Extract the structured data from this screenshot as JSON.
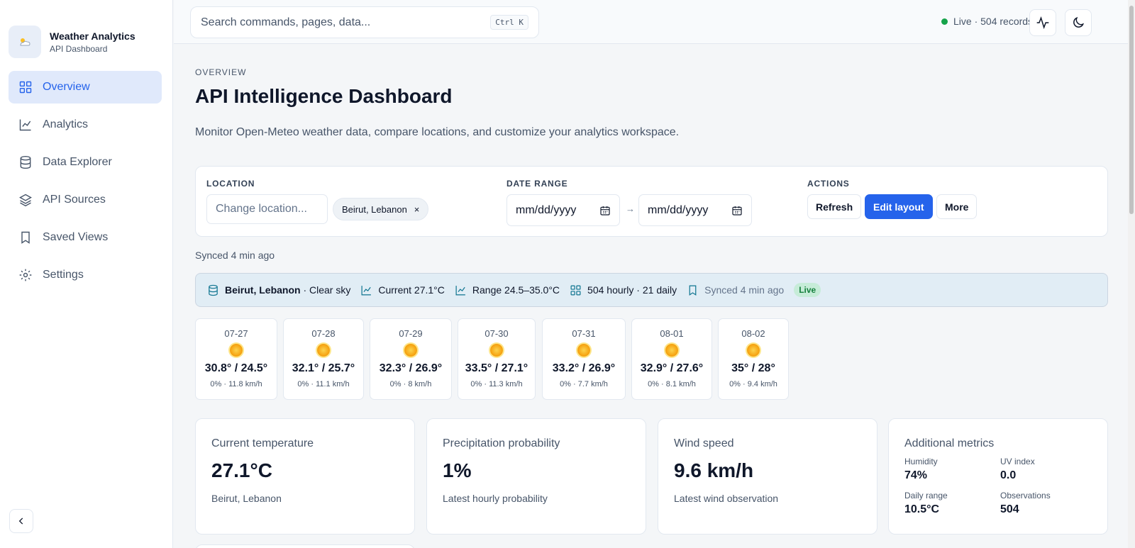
{
  "brand": {
    "title": "Weather Analytics",
    "subtitle": "API Dashboard",
    "logo_icon": "cloud-sun-icon"
  },
  "sidebar": {
    "items": [
      {
        "label": "Overview",
        "icon": "grid-icon",
        "active": true
      },
      {
        "label": "Analytics",
        "icon": "chart-line-icon",
        "active": false
      },
      {
        "label": "Data Explorer",
        "icon": "database-icon",
        "active": false
      },
      {
        "label": "API Sources",
        "icon": "layers-icon",
        "active": false
      },
      {
        "label": "Saved Views",
        "icon": "bookmark-icon",
        "active": false
      },
      {
        "label": "Settings",
        "icon": "gear-icon",
        "active": false
      }
    ],
    "collapse_icon": "chevron-left-icon"
  },
  "topbar": {
    "search_placeholder": "Search commands, pages, data...",
    "shortcut": "Ctrl K",
    "status": "Live · 504 records",
    "activity_icon": "activity-icon",
    "theme_icon": "moon-icon"
  },
  "page": {
    "breadcrumb": "OVERVIEW",
    "title": "API Intelligence Dashboard",
    "subtitle": "Monitor Open-Meteo weather data, compare locations, and customize your analytics workspace."
  },
  "controls": {
    "location_label": "LOCATION",
    "location_placeholder": "Change location...",
    "location_chip": "Beirut, Lebanon",
    "chip_close": "×",
    "date_label": "DATE RANGE",
    "date_from_placeholder": "mm/dd/yyyy",
    "date_to_placeholder": "mm/dd/yyyy",
    "arrow": "→",
    "actions_label": "ACTIONS",
    "refresh": "Refresh",
    "edit_layout": "Edit layout",
    "more": "More"
  },
  "synced": "Synced 4 min ago",
  "infobar": {
    "location": "Beirut, Lebanon",
    "condition": "· Clear sky",
    "current": "Current 27.1°C",
    "range": "Range 24.5–35.0°C",
    "records": "504 hourly · 21 daily",
    "synced": "Synced 4 min ago",
    "badge": "Live",
    "accent": "#0e7490"
  },
  "forecast": [
    {
      "date": "07-27",
      "temp": "30.8° / 24.5°",
      "meta": "0% · 11.8 km/h",
      "icon": "sun-icon"
    },
    {
      "date": "07-28",
      "temp": "32.1° / 25.7°",
      "meta": "0% · 11.1 km/h",
      "icon": "sun-icon"
    },
    {
      "date": "07-29",
      "temp": "32.3° / 26.9°",
      "meta": "0% · 8 km/h",
      "icon": "sun-icon"
    },
    {
      "date": "07-30",
      "temp": "33.5° / 27.1°",
      "meta": "0% · 11.3 km/h",
      "icon": "sun-icon"
    },
    {
      "date": "07-31",
      "temp": "33.2° / 26.9°",
      "meta": "0% · 7.7 km/h",
      "icon": "sun-icon"
    },
    {
      "date": "08-01",
      "temp": "32.9° / 27.6°",
      "meta": "0% · 8.1 km/h",
      "icon": "sun-icon"
    },
    {
      "date": "08-02",
      "temp": "35° / 28°",
      "meta": "0% · 9.4 km/h",
      "icon": "sun-icon"
    }
  ],
  "cards": {
    "temperature": {
      "label": "Current temperature",
      "value": "27.1°C",
      "sub": "Beirut, Lebanon"
    },
    "precipitation": {
      "label": "Precipitation probability",
      "value": "1%",
      "sub": "Latest hourly probability"
    },
    "wind": {
      "label": "Wind speed",
      "value": "9.6 km/h",
      "sub": "Latest wind observation"
    },
    "additional": {
      "label": "Additional metrics",
      "humidity_label": "Humidity",
      "humidity": "74%",
      "uv_label": "UV index",
      "uv": "0.0",
      "range_label": "Daily range",
      "range": "10.5°C",
      "obs_label": "Observations",
      "obs": "504"
    }
  },
  "colors": {
    "primary": "#2563eb",
    "live": "#16a34a"
  }
}
